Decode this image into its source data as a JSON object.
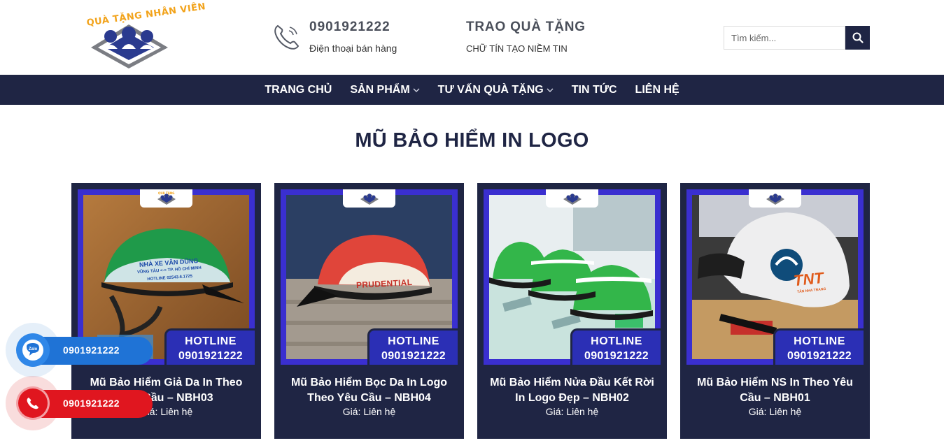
{
  "header": {
    "logo_text": "QUÀ TẶNG NHÂN VIÊN",
    "phone_number": "0901921222",
    "phone_subtitle": "Điện thoại bán hàng",
    "slogan_title": "TRAO QUÀ TẶNG",
    "slogan_subtitle": "CHỮ TÍN TẠO NIỀM TIN",
    "search_placeholder": "Tìm kiếm..."
  },
  "nav": {
    "items": [
      {
        "label": "TRANG CHỦ",
        "has_dropdown": false
      },
      {
        "label": "SẢN PHẨM",
        "has_dropdown": true
      },
      {
        "label": "TƯ VẤN QUÀ TẶNG",
        "has_dropdown": true
      },
      {
        "label": "TIN TỨC",
        "has_dropdown": false
      },
      {
        "label": "LIÊN HỆ",
        "has_dropdown": false
      }
    ]
  },
  "section": {
    "title": "MŨ BẢO HIỂM IN LOGO"
  },
  "products": [
    {
      "name": "Mũ Bảo Hiểm Giả Da In Theo Yêu Cầu – NBH03",
      "price": "Giá: Liên hệ",
      "hotline_label": "HOTLINE",
      "hotline_number": "0901921222",
      "helmet_text_1": "NHÀ XE VÂN DŨNG",
      "helmet_text_2": "VŨNG TÀU <-> TP. HỒ CHÍ MINH",
      "helmet_text_3": "HOTLINE 02543.6.1725"
    },
    {
      "name": "Mũ Bảo Hiểm Bọc Da In Logo Theo Yêu Cầu – NBH04",
      "price": "Giá: Liên hệ",
      "hotline_label": "HOTLINE",
      "hotline_number": "0901921222",
      "helmet_text_1": "PRUDENTIAL"
    },
    {
      "name": "Mũ Bảo Hiểm Nửa Đầu Kết Rời In Logo Đẹp – NBH02",
      "price": "Giá: Liên hệ",
      "hotline_label": "HOTLINE",
      "hotline_number": "0901921222"
    },
    {
      "name": "Mũ Bảo Hiểm NS In Theo Yêu Cầu – NBH01",
      "price": "Giá: Liên hệ",
      "hotline_label": "HOTLINE",
      "hotline_number": "0901921222",
      "helmet_text_1": "TNT",
      "helmet_text_2": "TÂN NHA TRANG"
    }
  ],
  "floating": {
    "zalo_icon_text": "Zalo",
    "zalo_number": "0901921222",
    "call_number": "0901921222"
  },
  "colors": {
    "brand_navy": "#1f2544",
    "hotline_blue": "#2b2fb5",
    "logo_orange": "#f2a31b",
    "zalo_blue": "#1f73d6",
    "call_red": "#e0161f"
  }
}
